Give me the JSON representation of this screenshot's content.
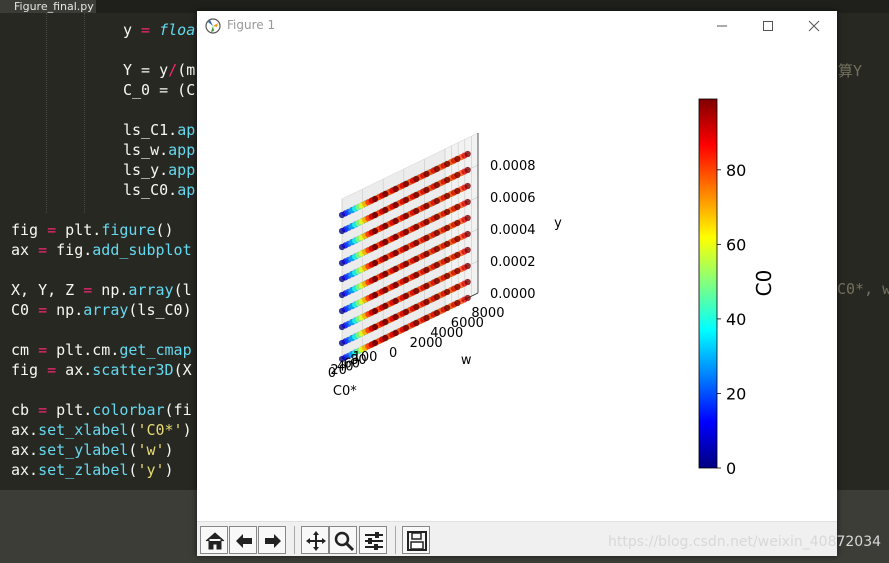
{
  "editor": {
    "tab_label": "Figure_final.py",
    "lines": [
      {
        "y": 30,
        "x": 123,
        "parts": [
          {
            "t": "y",
            "c": ""
          },
          {
            "t": " = ",
            "c": "kw"
          },
          {
            "t": "float",
            "c": "it"
          }
        ]
      },
      {
        "y": 70,
        "x": 123,
        "parts": [
          {
            "t": "Y = y",
            "c": ""
          },
          {
            "t": "/",
            "c": "kw"
          },
          {
            "t": "(m",
            "c": ""
          }
        ]
      },
      {
        "y": 90,
        "x": 123,
        "parts": [
          {
            "t": "C_0 = (C",
            "c": ""
          }
        ]
      },
      {
        "y": 130,
        "x": 123,
        "parts": [
          {
            "t": "ls_C1.",
            "c": ""
          },
          {
            "t": "ap",
            "c": "fn"
          }
        ]
      },
      {
        "y": 150,
        "x": 123,
        "parts": [
          {
            "t": "ls_w.",
            "c": ""
          },
          {
            "t": "app",
            "c": "fn"
          }
        ]
      },
      {
        "y": 170,
        "x": 123,
        "parts": [
          {
            "t": "ls_y.",
            "c": ""
          },
          {
            "t": "app",
            "c": "fn"
          }
        ]
      },
      {
        "y": 190,
        "x": 123,
        "parts": [
          {
            "t": "ls_C0.",
            "c": ""
          },
          {
            "t": "ap",
            "c": "fn"
          }
        ]
      },
      {
        "y": 230,
        "x": 11,
        "parts": [
          {
            "t": "fig ",
            "c": ""
          },
          {
            "t": "=",
            "c": "kw"
          },
          {
            "t": " plt.",
            "c": ""
          },
          {
            "t": "figure",
            "c": "fn"
          },
          {
            "t": "()",
            "c": ""
          }
        ]
      },
      {
        "y": 250,
        "x": 11,
        "parts": [
          {
            "t": "ax ",
            "c": ""
          },
          {
            "t": "=",
            "c": "kw"
          },
          {
            "t": " fig.",
            "c": ""
          },
          {
            "t": "add_subplot",
            "c": "fn"
          }
        ]
      },
      {
        "y": 290,
        "x": 11,
        "parts": [
          {
            "t": "X, Y, Z ",
            "c": ""
          },
          {
            "t": "=",
            "c": "kw"
          },
          {
            "t": " np.",
            "c": ""
          },
          {
            "t": "array",
            "c": "fn"
          },
          {
            "t": "(l",
            "c": ""
          }
        ]
      },
      {
        "y": 310,
        "x": 11,
        "parts": [
          {
            "t": "C0 ",
            "c": ""
          },
          {
            "t": "=",
            "c": "kw"
          },
          {
            "t": " np.",
            "c": ""
          },
          {
            "t": "array",
            "c": "fn"
          },
          {
            "t": "(ls_C0)",
            "c": ""
          }
        ]
      },
      {
        "y": 350,
        "x": 11,
        "parts": [
          {
            "t": "cm ",
            "c": ""
          },
          {
            "t": "=",
            "c": "kw"
          },
          {
            "t": " plt.cm.",
            "c": ""
          },
          {
            "t": "get_cmap",
            "c": "fn"
          }
        ]
      },
      {
        "y": 370,
        "x": 11,
        "parts": [
          {
            "t": "fig ",
            "c": ""
          },
          {
            "t": "=",
            "c": "kw"
          },
          {
            "t": " ax.",
            "c": ""
          },
          {
            "t": "scatter3D",
            "c": "fn"
          },
          {
            "t": "(X",
            "c": ""
          }
        ]
      },
      {
        "y": 410,
        "x": 11,
        "parts": [
          {
            "t": "cb ",
            "c": ""
          },
          {
            "t": "=",
            "c": "kw"
          },
          {
            "t": " plt.",
            "c": ""
          },
          {
            "t": "colorbar",
            "c": "fn"
          },
          {
            "t": "(fi",
            "c": ""
          }
        ]
      },
      {
        "y": 430,
        "x": 11,
        "parts": [
          {
            "t": "ax.",
            "c": ""
          },
          {
            "t": "set_xlabel",
            "c": "fn"
          },
          {
            "t": "(",
            "c": ""
          },
          {
            "t": "'C0*'",
            "c": "st"
          },
          {
            "t": ")",
            "c": ""
          }
        ]
      },
      {
        "y": 450,
        "x": 11,
        "parts": [
          {
            "t": "ax.",
            "c": ""
          },
          {
            "t": "set_ylabel",
            "c": "fn"
          },
          {
            "t": "(",
            "c": ""
          },
          {
            "t": "'w'",
            "c": "st"
          },
          {
            "t": ")",
            "c": ""
          }
        ]
      },
      {
        "y": 470,
        "x": 11,
        "parts": [
          {
            "t": "ax.",
            "c": ""
          },
          {
            "t": "set_zlabel",
            "c": "fn"
          },
          {
            "t": "(",
            "c": ""
          },
          {
            "t": "'y'",
            "c": "st"
          },
          {
            "t": ")",
            "c": ""
          }
        ]
      }
    ],
    "right_texts": [
      {
        "y": 70,
        "t": "算Y"
      },
      {
        "y": 290,
        "t": "C0*, w"
      }
    ]
  },
  "window": {
    "title": "Figure 1",
    "minimize_icon": "minimize-icon",
    "maximize_icon": "maximize-icon",
    "close_icon": "close-icon"
  },
  "toolbar": {
    "buttons": [
      "home-icon",
      "back-arrow-icon",
      "forward-arrow-icon",
      "pan-icon",
      "zoom-icon",
      "configure-subplots-icon",
      "save-icon"
    ]
  },
  "watermark": "https://blog.csdn.net/weixin_40872034",
  "chart_data": {
    "type": "scatter",
    "projection": "3d",
    "title": "",
    "xlabel": "C0*",
    "ylabel": "w",
    "zlabel": "y",
    "xlim": [
      0,
      100
    ],
    "ylim": [
      0,
      10000
    ],
    "zlim": [
      0,
      0.001
    ],
    "xticks": [
      "0",
      "20",
      "40",
      "60",
      "80",
      "100"
    ],
    "yticks": [
      "0",
      "2000",
      "4000",
      "6000",
      "8000"
    ],
    "zticks": [
      "0.0000",
      "0.0002",
      "0.0004",
      "0.0006",
      "0.0008"
    ],
    "x_values": [
      0,
      10,
      20,
      30,
      40,
      50,
      60,
      70,
      80,
      90,
      100
    ],
    "y_values": [
      0,
      1000,
      2000,
      3000,
      4000,
      5000,
      6000,
      7000,
      8000,
      9000
    ],
    "z_values": [
      0,
      0.0001,
      0.0002,
      0.0003,
      0.0004,
      0.0005,
      0.0006,
      0.0007,
      0.0008,
      0.0009
    ],
    "color_by": "C0",
    "colormap": "jet",
    "colorbar": {
      "label": "C0",
      "range": [
        0,
        99
      ],
      "ticks": [
        "0",
        "20",
        "40",
        "60",
        "80"
      ]
    },
    "grid": true
  }
}
